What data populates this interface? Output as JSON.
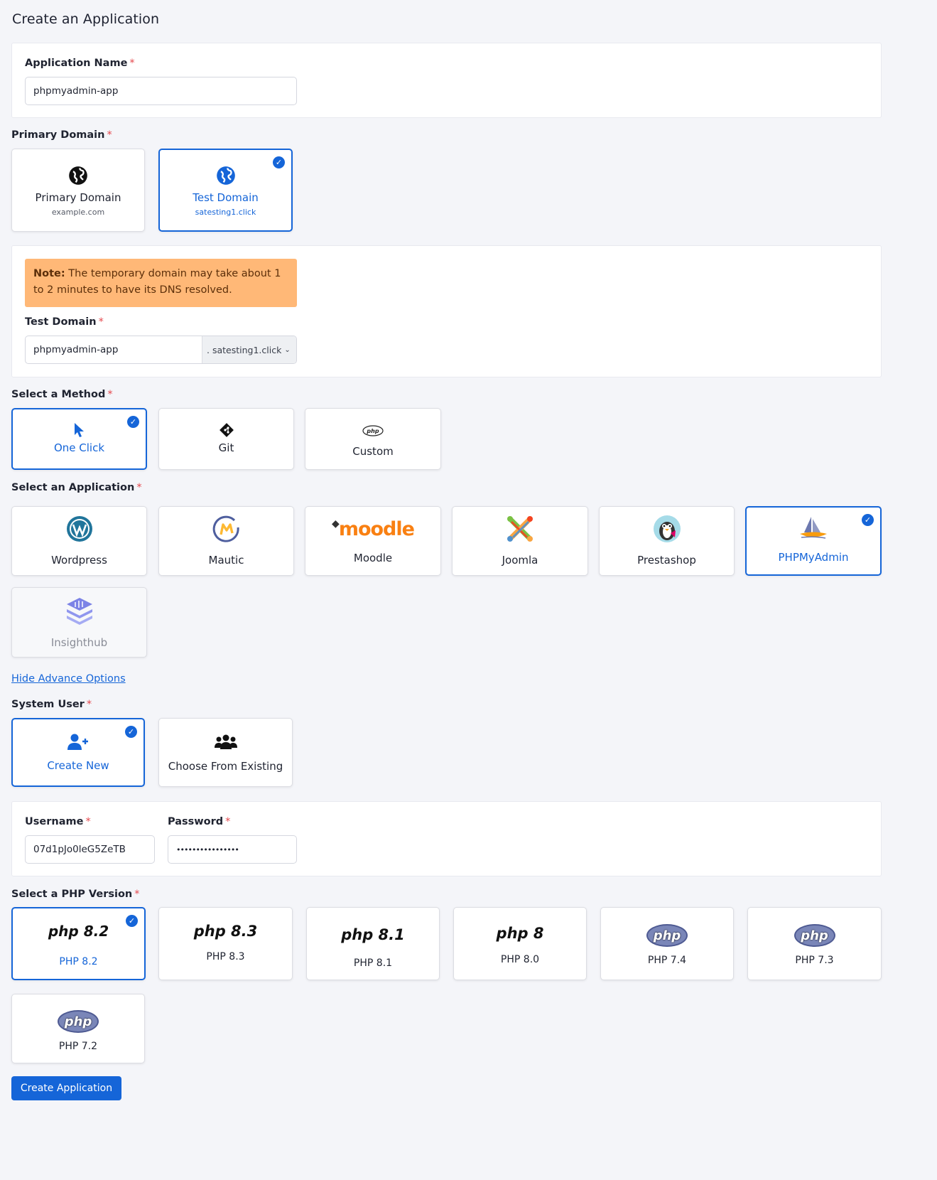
{
  "page": {
    "title": "Create an Application"
  },
  "app_name": {
    "label": "Application Name",
    "required": "*",
    "value": "phpmyadmin-app"
  },
  "primary_domain": {
    "label": "Primary Domain",
    "required": "*",
    "options": [
      {
        "title": "Primary Domain",
        "subtitle": "example.com",
        "icon": "globe-icon",
        "selected": false
      },
      {
        "title": "Test Domain",
        "subtitle": "satesting1.click",
        "icon": "globe-icon",
        "selected": true
      }
    ]
  },
  "note": {
    "bold": "Note:",
    "text": " The temporary domain may take about 1 to 2 minutes to have its DNS resolved."
  },
  "test_domain": {
    "label": "Test Domain",
    "required": "*",
    "value": "phpmyadmin-app",
    "suffix": ". satesting1.click"
  },
  "method": {
    "label": "Select a Method",
    "required": "*",
    "options": [
      {
        "title": "One Click",
        "icon": "cursor-icon",
        "selected": true
      },
      {
        "title": "Git",
        "icon": "git-icon",
        "selected": false
      },
      {
        "title": "Custom",
        "icon": "php-icon",
        "selected": false
      }
    ]
  },
  "application": {
    "label": "Select an Application",
    "required": "*",
    "options": [
      {
        "title": "Wordpress",
        "icon": "wordpress-icon",
        "selected": false
      },
      {
        "title": "Mautic",
        "icon": "mautic-icon",
        "selected": false
      },
      {
        "title": "Moodle",
        "icon": "moodle-icon",
        "logo_text": "moodle",
        "selected": false
      },
      {
        "title": "Joomla",
        "icon": "joomla-icon",
        "selected": false
      },
      {
        "title": "Prestashop",
        "icon": "prestashop-icon",
        "selected": false
      },
      {
        "title": "PHPMyAdmin",
        "icon": "phpmyadmin-icon",
        "selected": true
      },
      {
        "title": "Insighthub",
        "icon": "insighthub-icon",
        "selected": false,
        "disabled": true
      }
    ]
  },
  "advance": {
    "link": "Hide Advance Options"
  },
  "system_user": {
    "label": "System User",
    "required": "*",
    "options": [
      {
        "title": "Create New",
        "icon": "user-plus-icon",
        "selected": true
      },
      {
        "title": "Choose From Existing",
        "icon": "users-icon",
        "selected": false
      }
    ]
  },
  "credentials": {
    "username_label": "Username",
    "username_value": "07d1pJo0leG5ZeTB",
    "password_label": "Password",
    "password_value": "••••••••••••••••",
    "required": "*"
  },
  "php": {
    "label": "Select a PHP Version",
    "required": "*",
    "options": [
      {
        "title": "PHP 8.2",
        "logo": "php 8.2",
        "selected": true
      },
      {
        "title": "PHP 8.3",
        "logo": "php 8.3",
        "selected": false
      },
      {
        "title": "PHP 8.1",
        "logo": "php 8.1",
        "selected": false
      },
      {
        "title": "PHP 8.0",
        "logo": "php 8",
        "selected": false
      },
      {
        "title": "PHP 7.4",
        "logo": "php",
        "selected": false
      },
      {
        "title": "PHP 7.3",
        "logo": "php",
        "selected": false
      },
      {
        "title": "PHP 7.2",
        "logo": "php",
        "selected": false
      }
    ]
  },
  "submit": {
    "label": "Create Application"
  },
  "colors": {
    "accent": "#1565d8",
    "note_bg": "#ffb877",
    "required": "#e5484d"
  }
}
